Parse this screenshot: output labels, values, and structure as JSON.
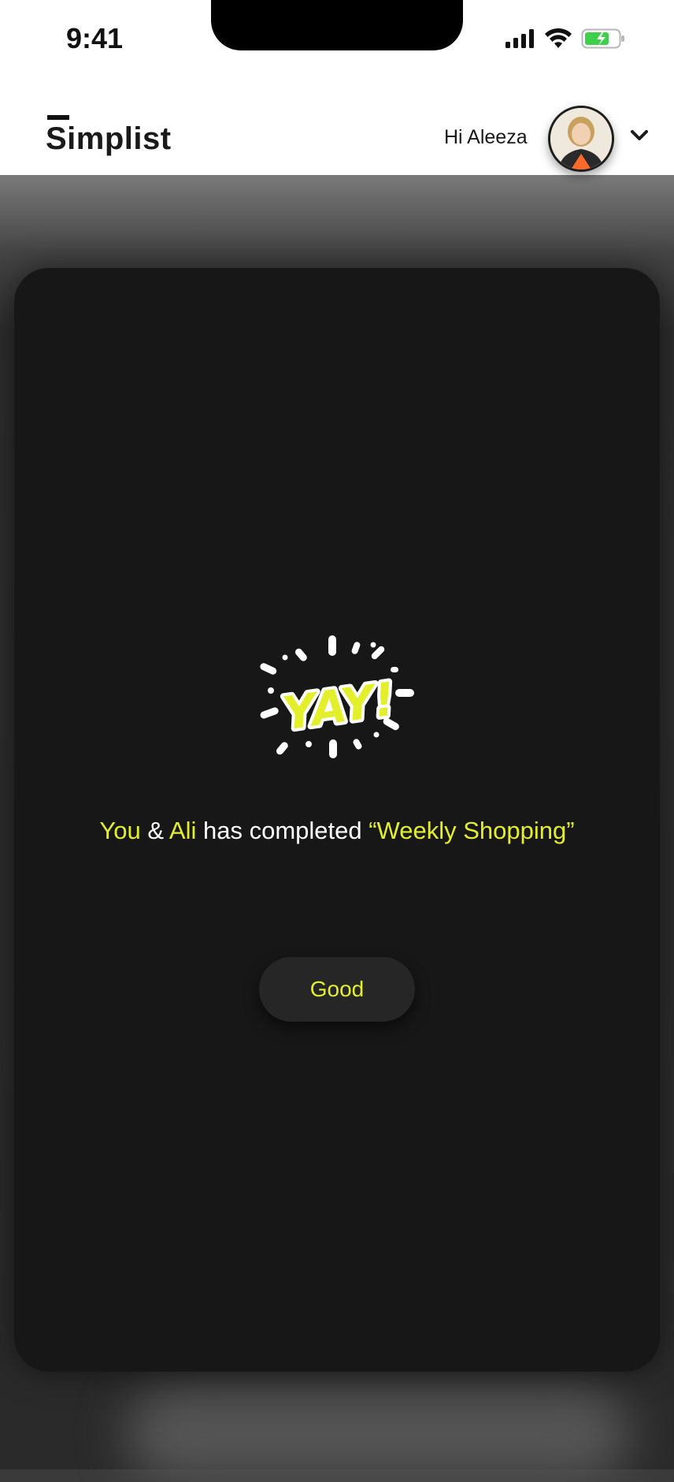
{
  "status_bar": {
    "time": "9:41",
    "icons": [
      "cellular-signal-icon",
      "wifi-icon",
      "battery-charging-icon"
    ]
  },
  "header": {
    "logo": "Simplist",
    "greeting": "Hi Aleeza",
    "avatar_icon": "user-avatar",
    "menu_icon": "chevron-down-icon"
  },
  "modal": {
    "illustration": "yay-celebration-icon",
    "illustration_text": "YAY!",
    "message": {
      "part1": "You",
      "part2": " & ",
      "part3": "Ali",
      "part4": " has completed ",
      "part5": "“Weekly Shopping”"
    },
    "button_label": "Good"
  },
  "colors": {
    "accent": "#e4ef2b",
    "modal_bg": "#171717",
    "button_bg": "#262626",
    "battery": "#3ecf4c"
  }
}
